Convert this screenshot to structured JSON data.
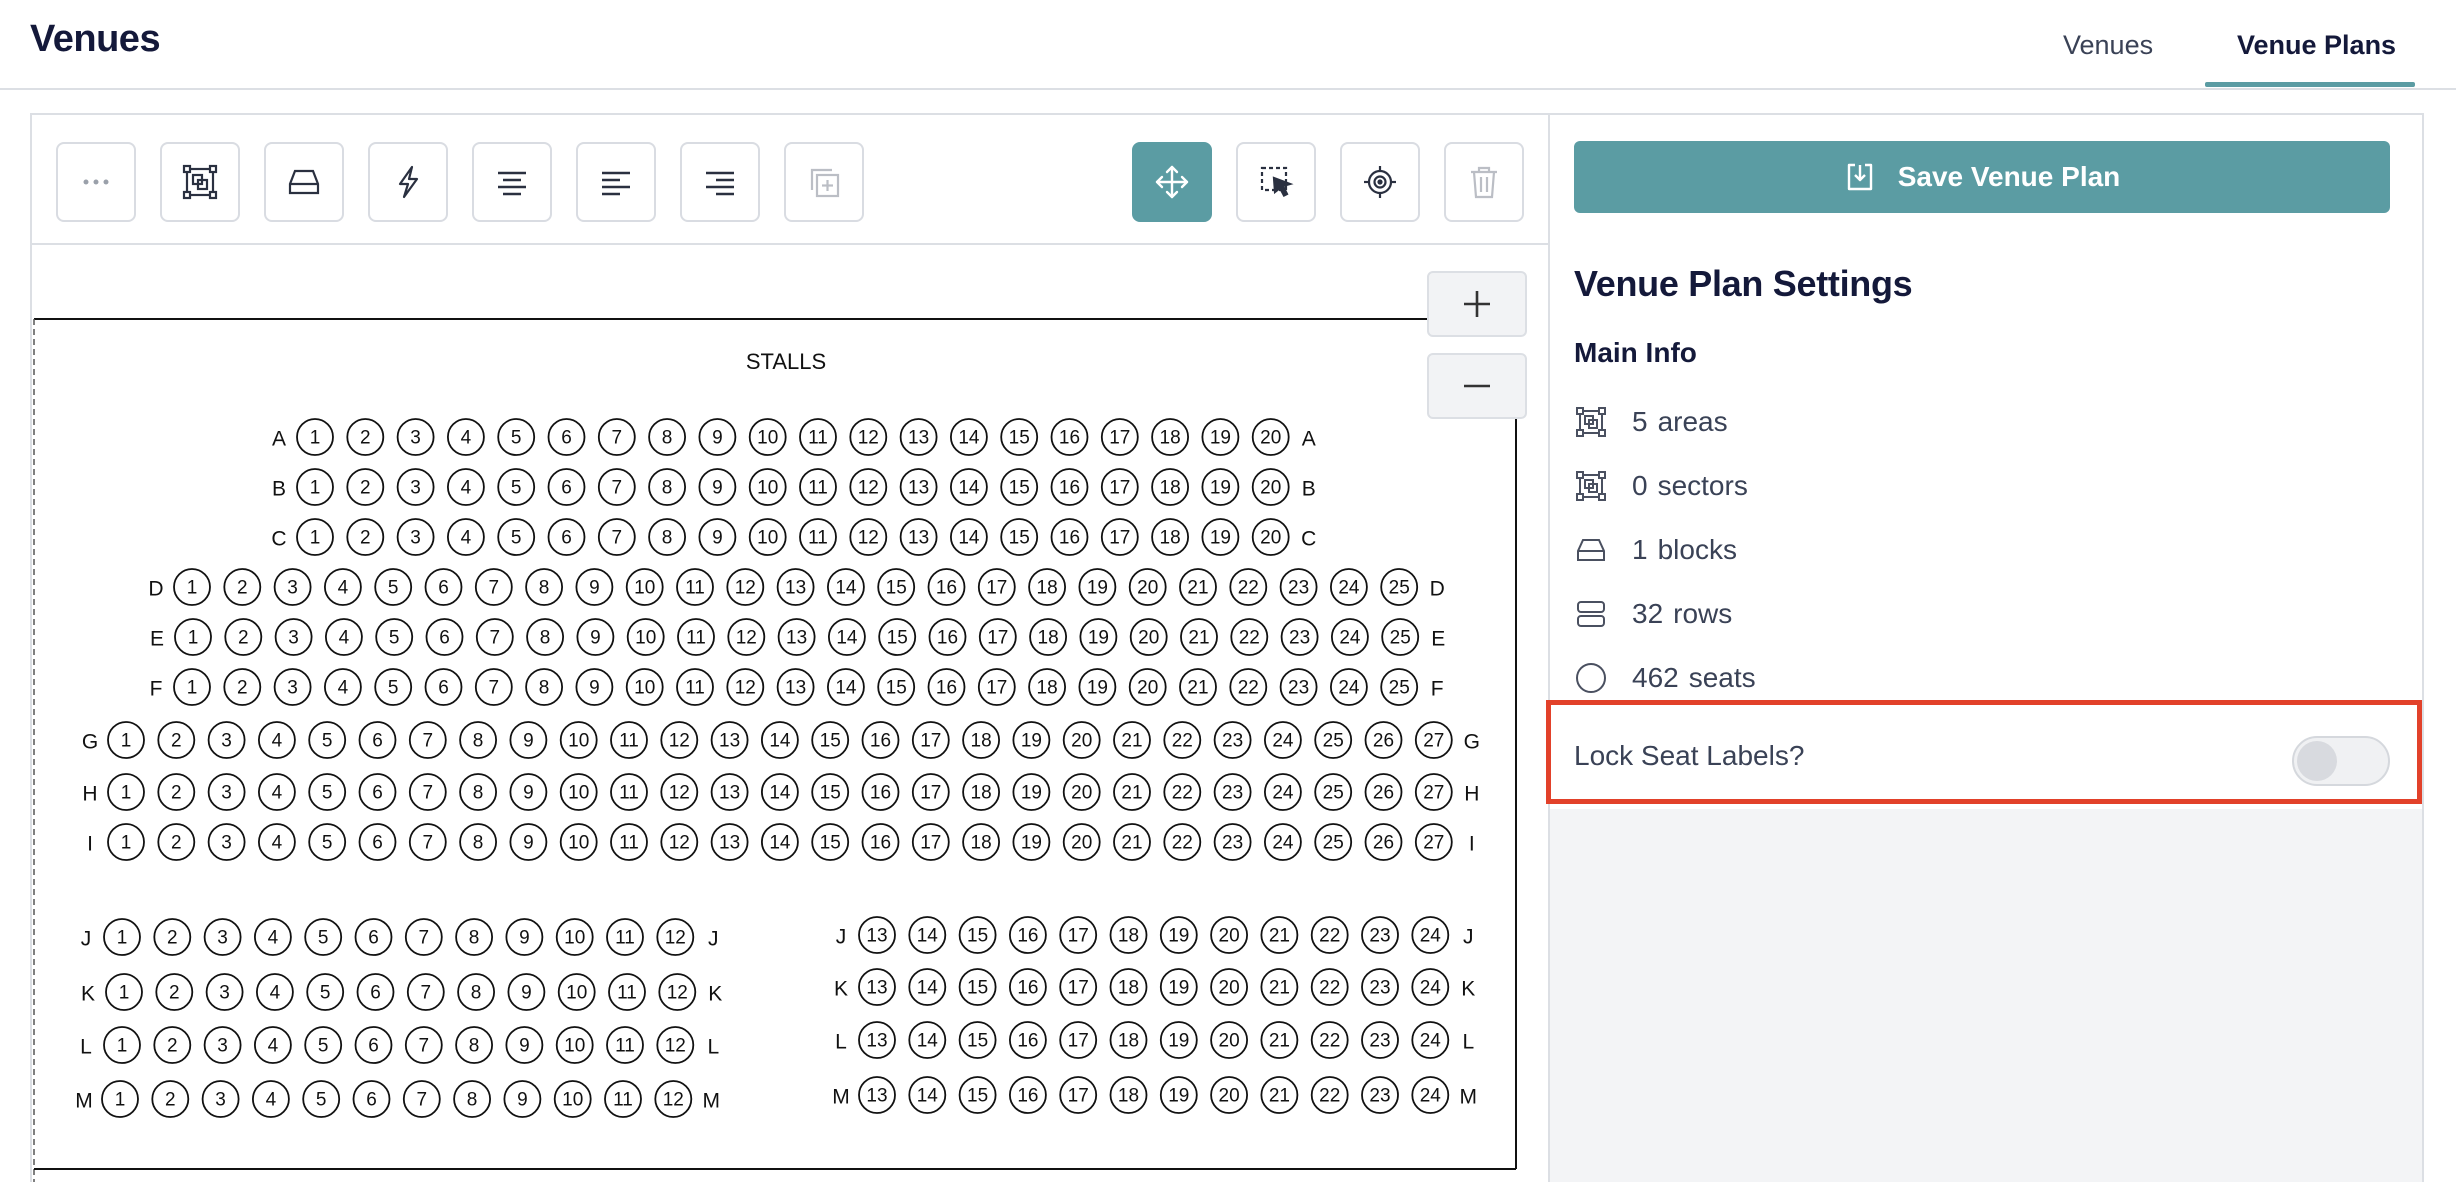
{
  "header": {
    "title": "Venues",
    "tabs": [
      {
        "label": "Venues",
        "active": false
      },
      {
        "label": "Venue Plans",
        "active": true
      }
    ]
  },
  "toolbar": {
    "tools": [
      {
        "name": "more-options",
        "icon": "ellipsis-icon"
      },
      {
        "name": "area",
        "icon": "area-icon"
      },
      {
        "name": "block",
        "icon": "block-icon"
      },
      {
        "name": "quick-action",
        "icon": "lightning-icon"
      },
      {
        "name": "align-center",
        "icon": "align-center-icon"
      },
      {
        "name": "align-left",
        "icon": "align-left-icon"
      },
      {
        "name": "align-right",
        "icon": "align-right-icon"
      },
      {
        "name": "duplicate",
        "icon": "duplicate-icon",
        "disabled": true
      },
      {
        "name": "move",
        "icon": "move-icon",
        "active": true
      },
      {
        "name": "select",
        "icon": "select-icon"
      },
      {
        "name": "focus",
        "icon": "target-icon"
      },
      {
        "name": "delete",
        "icon": "trash-icon",
        "disabled": true
      }
    ],
    "active_color": "#5b9ca3"
  },
  "seatmap": {
    "area_label": "STALLS",
    "rows": [
      {
        "label": "A",
        "from": 1,
        "to": 20
      },
      {
        "label": "B",
        "from": 1,
        "to": 20
      },
      {
        "label": "C",
        "from": 1,
        "to": 20
      },
      {
        "label": "D",
        "from": 1,
        "to": 25
      },
      {
        "label": "E",
        "from": 1,
        "to": 25
      },
      {
        "label": "F",
        "from": 1,
        "to": 25
      },
      {
        "label": "G",
        "from": 1,
        "to": 27
      },
      {
        "label": "H",
        "from": 1,
        "to": 27
      },
      {
        "label": "I",
        "from": 1,
        "to": 27
      },
      {
        "label": "J",
        "from": 1,
        "to": 12
      },
      {
        "label": "K",
        "from": 1,
        "to": 12
      },
      {
        "label": "L",
        "from": 1,
        "to": 12
      },
      {
        "label": "M",
        "from": 1,
        "to": 12
      },
      {
        "label": "J",
        "from": 13,
        "to": 24
      },
      {
        "label": "K",
        "from": 13,
        "to": 24
      },
      {
        "label": "L",
        "from": 13,
        "to": 24
      },
      {
        "label": "M",
        "from": 13,
        "to": 24
      }
    ]
  },
  "settings": {
    "save_label": "Save Venue Plan",
    "title": "Venue Plan Settings",
    "main_info_title": "Main Info",
    "areas": {
      "value": "5",
      "unit": "areas",
      "icon": "area-icon"
    },
    "sectors": {
      "value": "0",
      "unit": "sectors",
      "icon": "sector-icon"
    },
    "blocks": {
      "value": "1",
      "unit": "blocks",
      "icon": "block-icon"
    },
    "rows": {
      "value": "32",
      "unit": "rows",
      "icon": "rows-icon"
    },
    "seats": {
      "value": "462",
      "unit": "seats",
      "icon": "seat-icon"
    },
    "lock_label": "Lock Seat Labels?",
    "lock_enabled": false,
    "highlight_color": "#e2412a"
  }
}
